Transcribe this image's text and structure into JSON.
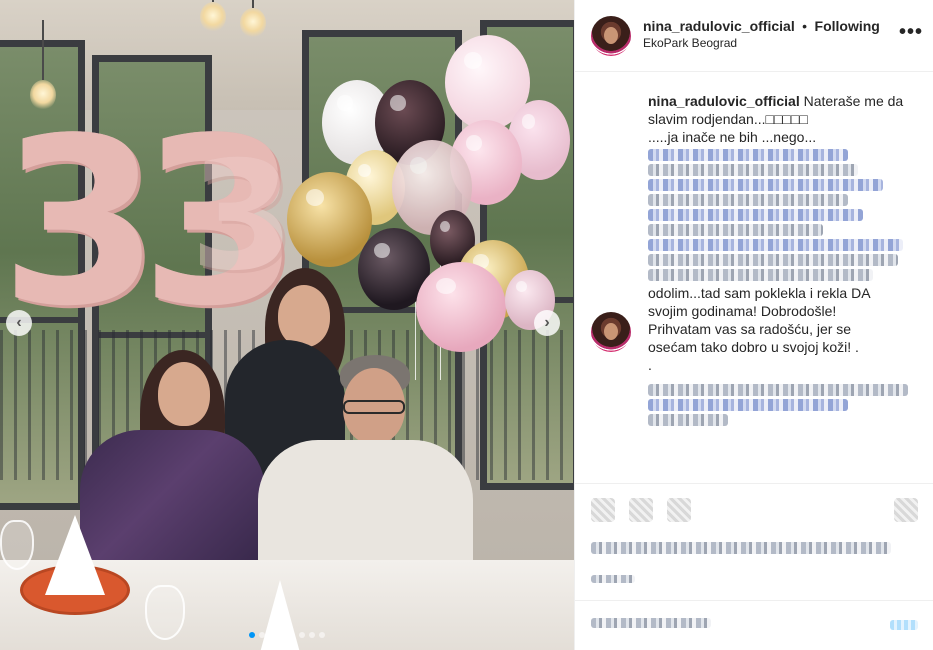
{
  "post": {
    "photo_alt": "Birthday celebration photo",
    "carousel": {
      "dot_count": 8,
      "active_index": 0
    }
  },
  "header": {
    "username": "nina_radulovic_official",
    "separator": "•",
    "follow_label": "Following",
    "location": "EkoPark Beograd",
    "more_icon": "more-dots-icon",
    "more_glyph": "•••"
  },
  "caption": {
    "username": "nina_radulovic_official",
    "line1": "Nateraše me da slavim rodjendan...□□□□□",
    "line2": ".....ja inače ne bih ...nego...",
    "continued": [
      "odolim...tad sam poklekla i rekla DA",
      "svojim godinama! Dobrodošle!",
      "Prihvatam vas sa radošću, jer se",
      "osećam tako dobro u svojoj koži! .",
      "."
    ]
  },
  "nav": {
    "prev_glyph": "‹",
    "next_glyph": "›"
  },
  "colors": {
    "accent": "#0095f6",
    "text": "#262626",
    "border": "#efefef"
  }
}
